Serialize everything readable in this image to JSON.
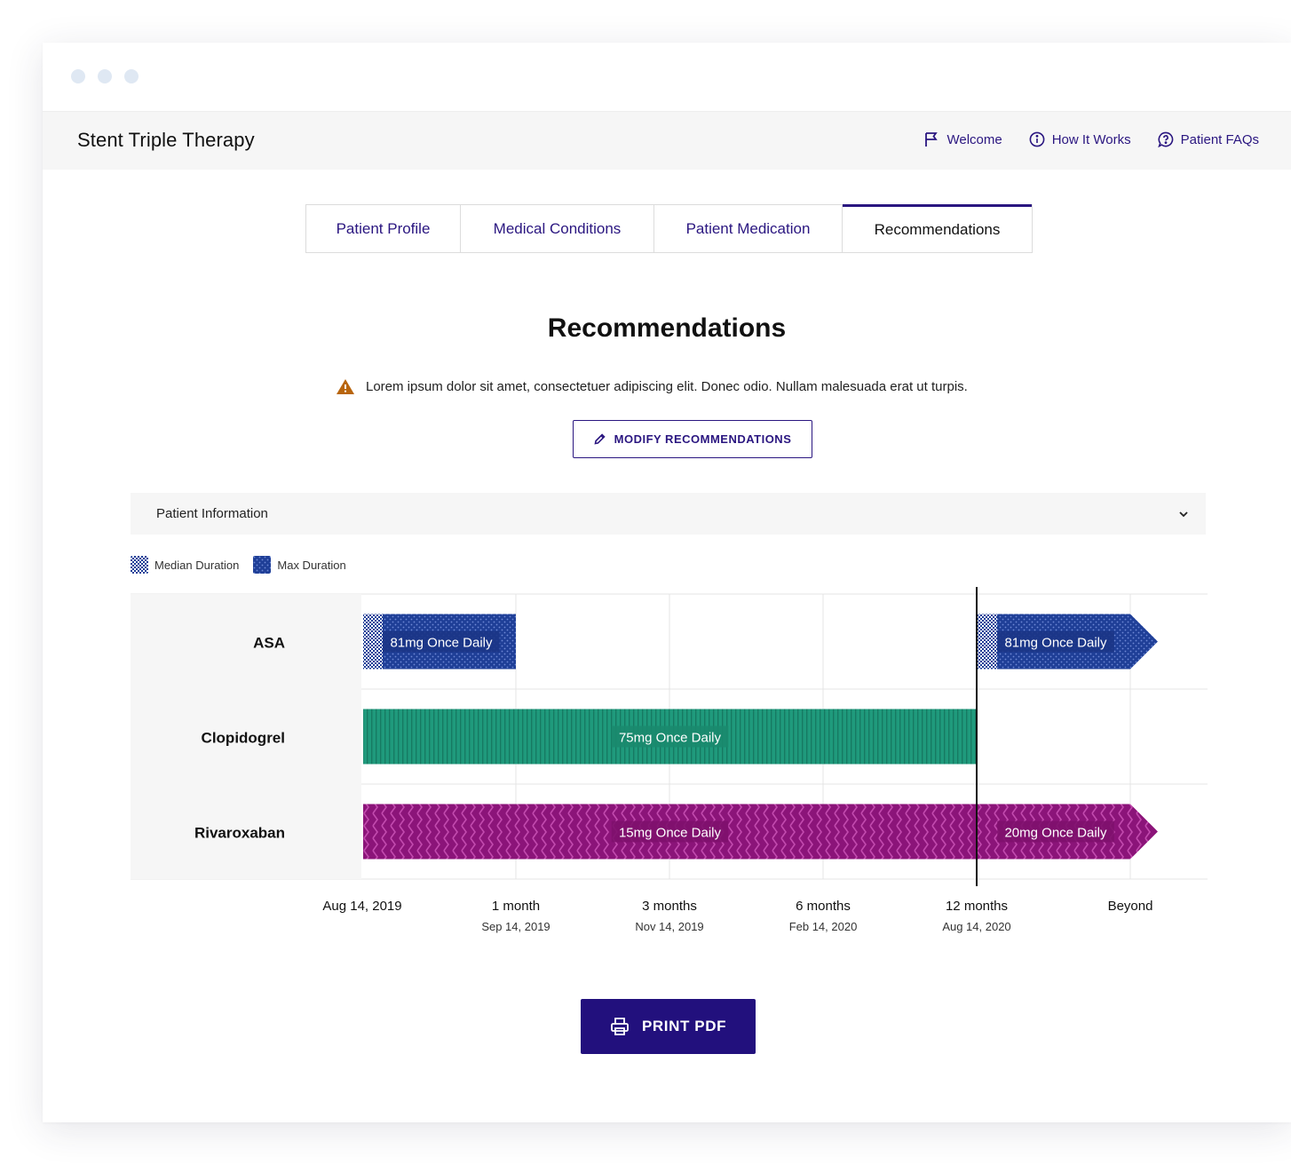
{
  "app": {
    "title": "Stent Triple Therapy",
    "nav": [
      {
        "label": "Welcome",
        "icon": "flag-icon"
      },
      {
        "label": "How It Works",
        "icon": "info-icon"
      },
      {
        "label": "Patient FAQs",
        "icon": "question-icon"
      }
    ]
  },
  "tabs": [
    {
      "label": "Patient Profile",
      "active": false
    },
    {
      "label": "Medical Conditions",
      "active": false
    },
    {
      "label": "Patient Medication",
      "active": false
    },
    {
      "label": "Recommendations",
      "active": true
    }
  ],
  "main": {
    "heading": "Recommendations",
    "warning": "Lorem ipsum dolor sit amet, consectetuer adipiscing elit. Donec odio. Nullam malesuada erat ut turpis.",
    "modify_button": "MODIFY RECOMMENDATIONS",
    "accordion_label": "Patient Information",
    "print_button": "PRINT PDF"
  },
  "legend": [
    {
      "label": "Median Duration",
      "pattern": "median"
    },
    {
      "label": "Max Duration",
      "pattern": "max"
    }
  ],
  "colors": {
    "brand": "#22107d",
    "link": "#2a1680",
    "asa": "#1f3f97",
    "clopidogrel": "#1f9a7c",
    "rivaroxaban": "#8b1479",
    "warning": "#b8650d"
  },
  "chart_data": {
    "type": "gantt",
    "ticks": [
      {
        "label": "Aug 14, 2019",
        "date": ""
      },
      {
        "label": "1 month",
        "date": "Sep 14, 2019"
      },
      {
        "label": "3 months",
        "date": "Nov 14, 2019"
      },
      {
        "label": "6 months",
        "date": "Feb 14, 2020"
      },
      {
        "label": "12 months",
        "date": "Aug 14, 2020"
      },
      {
        "label": "Beyond",
        "date": ""
      }
    ],
    "current_marker": "12 months",
    "rows": [
      {
        "name": "ASA",
        "bars": [
          {
            "label": "81mg Once Daily",
            "start": "Aug 14, 2019",
            "end": "1 month",
            "style": "asa",
            "median_end": "Aug 14, 2019",
            "arrow": false
          },
          {
            "label": "81mg Once Daily",
            "start": "12 months",
            "end": "Beyond",
            "style": "asa",
            "median_end": "12 months",
            "arrow": true
          }
        ]
      },
      {
        "name": "Clopidogrel",
        "bars": [
          {
            "label": "75mg Once Daily",
            "start": "Aug 14, 2019",
            "end": "12 months",
            "style": "clopidogrel",
            "arrow": false
          }
        ]
      },
      {
        "name": "Rivaroxaban",
        "bars": [
          {
            "label": "15mg Once Daily",
            "start": "Aug 14, 2019",
            "end": "12 months",
            "style": "rivaroxaban",
            "arrow": false
          },
          {
            "label": "20mg Once Daily",
            "start": "12 months",
            "end": "Beyond",
            "style": "rivaroxaban",
            "arrow": true
          }
        ]
      }
    ]
  }
}
